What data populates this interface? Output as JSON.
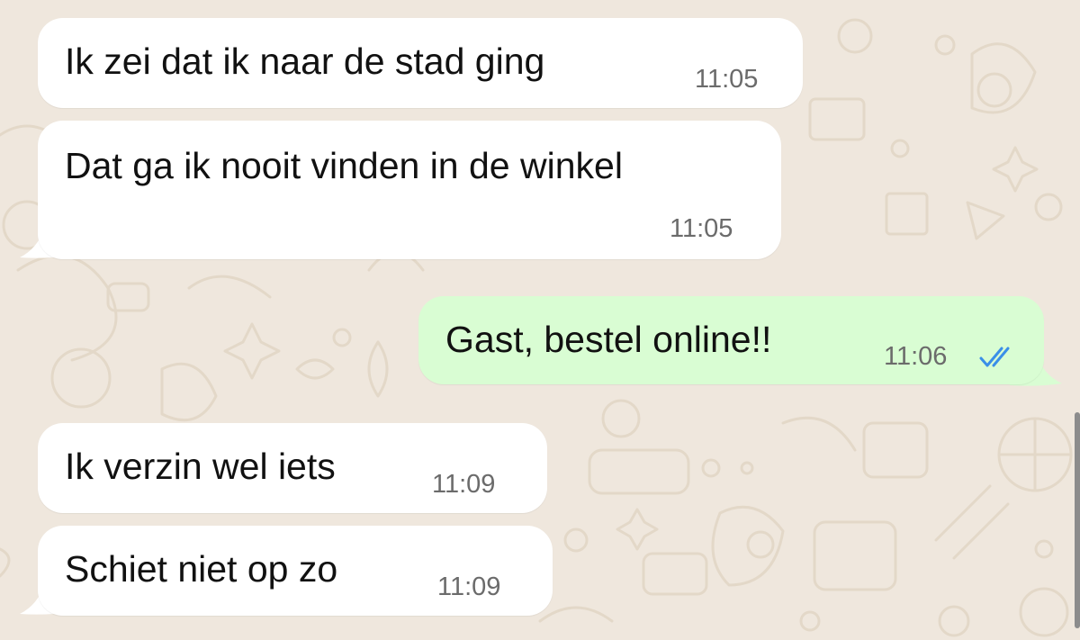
{
  "chat": {
    "messages": [
      {
        "direction": "incoming",
        "text": "Ik zei dat ik naar de stad ging",
        "time": "11:05"
      },
      {
        "direction": "incoming",
        "text": "Dat ga ik nooit vinden in de winkel",
        "time": "11:05"
      },
      {
        "direction": "outgoing",
        "text": "Gast, bestel online!!",
        "time": "11:06",
        "status": "read",
        "status_icon": "double-check-icon"
      },
      {
        "direction": "incoming",
        "text": "Ik verzin wel iets",
        "time": "11:09"
      },
      {
        "direction": "incoming",
        "text": "Schiet niet op zo",
        "time": "11:09"
      }
    ]
  },
  "colors": {
    "wallpaper": "#efe7dd",
    "incoming_bubble": "#ffffff",
    "outgoing_bubble": "#d9fdd3",
    "read_ticks": "#3a8fe8",
    "timestamp": "#6b6b6b"
  }
}
